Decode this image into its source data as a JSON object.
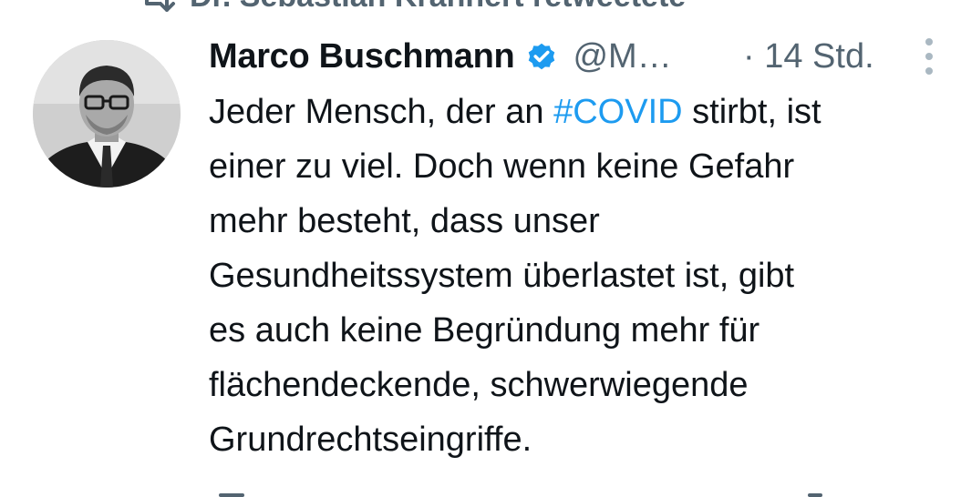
{
  "retweet": {
    "label": "Dr. Sebastian Krannert retweetete",
    "icon": "retweet-icon"
  },
  "tweet": {
    "author": {
      "display_name": "Marco Buschmann",
      "handle": "@M…",
      "verified": true,
      "avatar": "avatar-photo"
    },
    "timestamp": "· 14 Std.",
    "text_before": "Jeder Mensch, der an ",
    "hashtag": "#COVID",
    "text_after": " stirbt, ist\neiner zu viel. Doch wenn keine Gefahr\nmehr besteht, dass unser\nGesundheitssystem überlastet ist, gibt\nes auch keine Begründung mehr für\nflächendeckende, schwerwiegende\nGrundrechtseingriffe.",
    "more_icon": "more-options-icon"
  },
  "colors": {
    "text": "#0f1419",
    "secondary": "#536471",
    "accent": "#1d9bf0"
  }
}
